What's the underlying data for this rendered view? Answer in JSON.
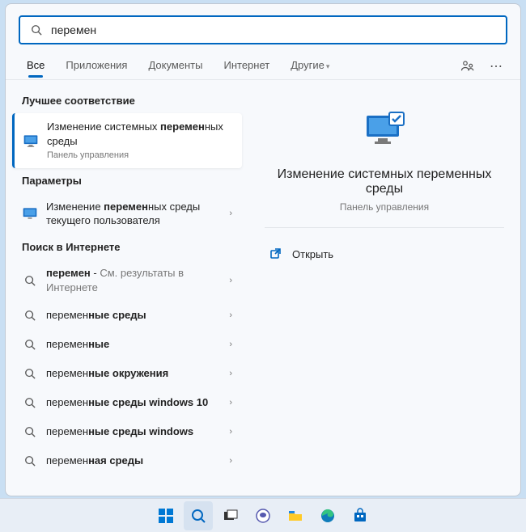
{
  "search": {
    "query": "перемен"
  },
  "tabs": {
    "all": "Все",
    "apps": "Приложения",
    "docs": "Документы",
    "web": "Интернет",
    "more": "Другие"
  },
  "sections": {
    "best": "Лучшее соответствие",
    "settings": "Параметры",
    "web": "Поиск в Интернете"
  },
  "best_match": {
    "line1_pre": "Изменение системных ",
    "line1_bold": "перемен",
    "line1_post": "ных среды",
    "sub": "Панель управления"
  },
  "settings_item": {
    "pre": "Изменение ",
    "bold": "перемен",
    "post": "ных среды текущего пользователя"
  },
  "web_items": [
    {
      "bold": "перемен",
      "post": " - ",
      "dim": "См. результаты в Интернете"
    },
    {
      "pre": "перемен",
      "bold": "ные среды"
    },
    {
      "pre": "перемен",
      "bold": "ные"
    },
    {
      "pre": "перемен",
      "bold": "ные окружения"
    },
    {
      "pre": "перемен",
      "bold": "ные среды windows 10"
    },
    {
      "pre": "перемен",
      "bold": "ные среды windows"
    },
    {
      "pre": "перемен",
      "bold": "ная среды"
    }
  ],
  "preview": {
    "title": "Изменение системных переменных среды",
    "sub": "Панель управления",
    "open": "Открыть"
  }
}
